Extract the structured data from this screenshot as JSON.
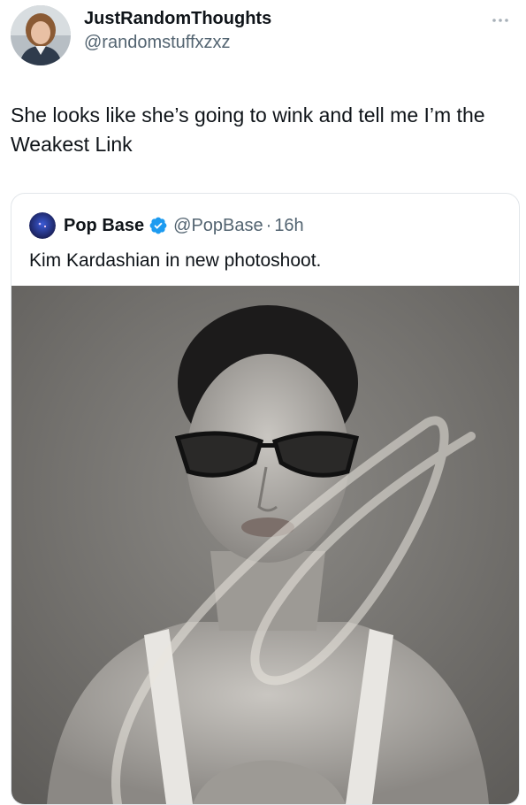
{
  "tweet": {
    "display_name": "JustRandomThoughts",
    "handle": "@randomstuffxzxz",
    "text": "She looks like she’s going to wink and tell me I’m the Weakest Link",
    "avatar_icon": "profile-avatar-woman",
    "more_icon": "more-options-icon"
  },
  "quoted_tweet": {
    "display_name": "Pop Base",
    "handle": "@PopBase",
    "separator": "·",
    "time": "16h",
    "text": "Kim Kardashian in new photoshoot.",
    "avatar_icon": "pop-base-logo",
    "verified_icon": "verified-badge-icon",
    "verified_color": "#1d9bf0",
    "media_icon": "black-and-white-portrait-photo"
  },
  "colors": {
    "primary_text": "#0f1419",
    "secondary_text": "#536471",
    "card_border": "#e2e6ea",
    "background": "#ffffff"
  }
}
